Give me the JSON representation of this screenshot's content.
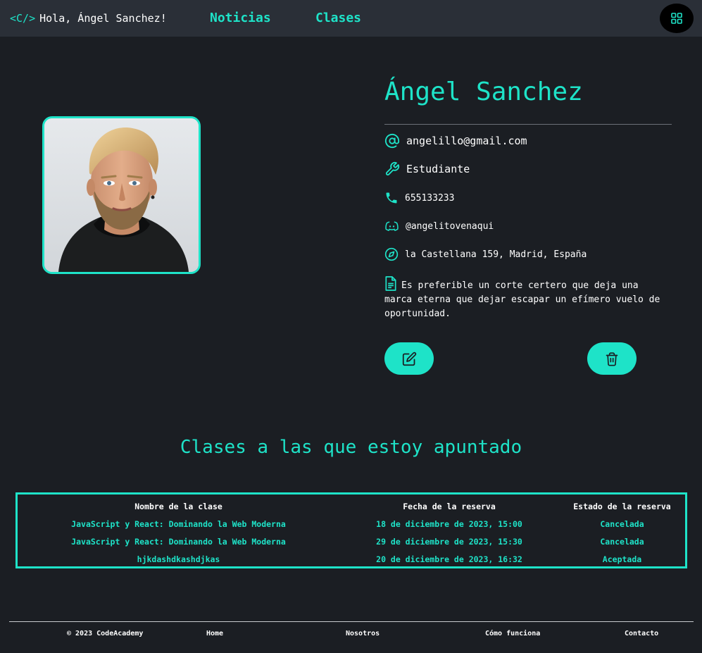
{
  "header": {
    "logo": "<C/>",
    "greeting": "Hola, Ángel Sanchez!",
    "nav": [
      {
        "label": "Noticias"
      },
      {
        "label": "Clases"
      }
    ]
  },
  "profile": {
    "name": "Ángel Sanchez",
    "email": "angelillo@gmail.com",
    "role": "Estudiante",
    "phone": "655133233",
    "discord": "@angelitovenaqui",
    "address": "la Castellana 159, Madrid, España",
    "bio": "Es preferible un corte certero que deja una marca eterna que dejar escapar un efímero vuelo de oportunidad."
  },
  "classes": {
    "title": "Clases a las que estoy apuntado",
    "headers": [
      "Nombre de la clase",
      "Fecha de la reserva",
      "Estado de la reserva"
    ],
    "rows": [
      [
        "JavaScript y React: Dominando la Web Moderna",
        "18 de diciembre de 2023, 15:00",
        "Cancelada"
      ],
      [
        "JavaScript y React: Dominando la Web Moderna",
        "29 de diciembre de 2023, 15:30",
        "Cancelada"
      ],
      [
        "hjkdashdkashdjkas",
        "20 de diciembre de 2023, 16:32",
        "Aceptada"
      ]
    ]
  },
  "footer": {
    "copyright": "© 2023 CodeAcademy",
    "links": [
      "Home",
      "Nosotros",
      "Cómo funciona",
      "Contacto"
    ]
  },
  "colors": {
    "accent": "#1ee3c8",
    "background": "#1b1e23",
    "header_bg": "#2a2f37"
  },
  "icons": [
    "grid-icon",
    "at-icon",
    "wrench-icon",
    "phone-icon",
    "discord-icon",
    "compass-icon",
    "document-icon",
    "edit-icon",
    "trash-icon"
  ]
}
